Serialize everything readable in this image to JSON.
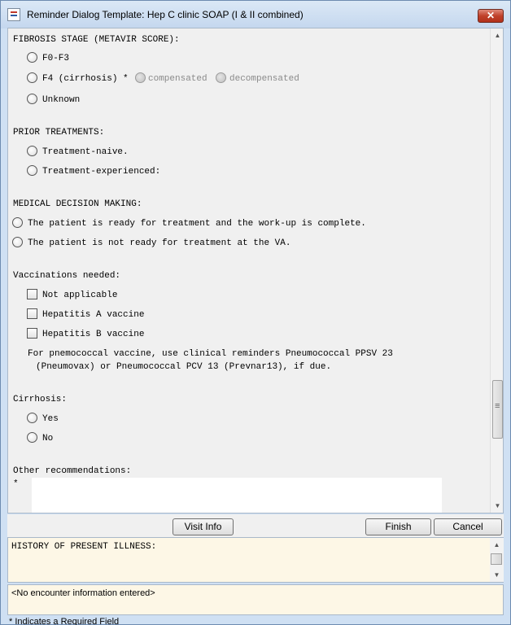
{
  "window": {
    "title": "Reminder Dialog Template: Hep C clinic SOAP (I & II combined)",
    "close_glyph": "✕"
  },
  "form": {
    "fibrosis": {
      "heading": "FIBROSIS STAGE (METAVIR SCORE):",
      "options": [
        "F0-F3",
        "F4 (cirrhosis) *",
        "Unknown"
      ],
      "sub_options": [
        "compensated",
        "decompensated"
      ]
    },
    "prior": {
      "heading": "PRIOR TREATMENTS:",
      "options": [
        "Treatment-naive.",
        "Treatment-experienced:"
      ]
    },
    "mdm": {
      "heading": "MEDICAL DECISION MAKING:",
      "options": [
        "The patient is ready for treatment and the work-up is complete.",
        "The patient is not ready for treatment at the VA."
      ]
    },
    "vaccinations": {
      "heading": "Vaccinations needed:",
      "options": [
        "Not applicable",
        "Hepatitis A vaccine",
        "Hepatitis B vaccine"
      ],
      "note_line1": "For pnemococcal vaccine, use clinical reminders Pneumococcal PPSV 23",
      "note_line2": "(Pneumovax) or Pneumococcal PCV 13 (Prevnar13), if due."
    },
    "cirrhosis": {
      "heading": "Cirrhosis:",
      "options": [
        "Yes",
        "No"
      ]
    },
    "other": {
      "heading": "Other recommendations:",
      "required_marker": "*",
      "value": ""
    }
  },
  "buttons": {
    "visit_info": "Visit Info",
    "finish": "Finish",
    "cancel": "Cancel"
  },
  "history_text": "HISTORY OF PRESENT ILLNESS:",
  "encounter_text": "<No encounter information entered>",
  "footer_text": "* Indicates a Required Field",
  "scroll": {
    "up_glyph": "▲",
    "down_glyph": "▼"
  }
}
